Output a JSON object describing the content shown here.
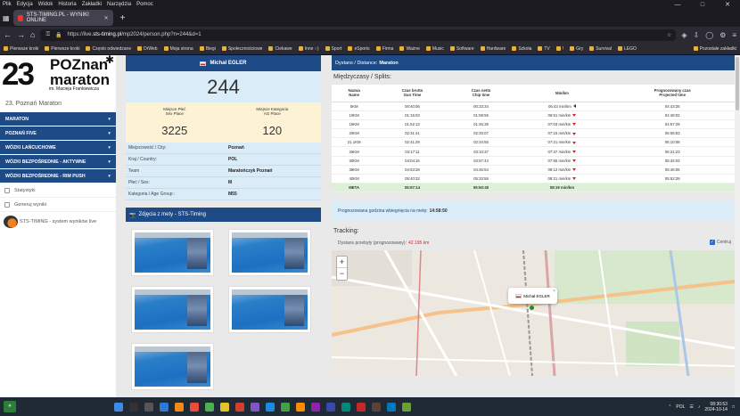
{
  "browser": {
    "menu": [
      "Plik",
      "Edycja",
      "Widok",
      "Historia",
      "Zakładki",
      "Narzędzia",
      "Pomoc"
    ],
    "tab_title": "STS-TIMING.PL - WYNIKI ONLINE",
    "url_prefix": "https://live.",
    "url_host": "sts-timing.pl",
    "url_rest": "/mp2024/person.php?n=244&d=1",
    "bookmarks": [
      "Pierwsze kroki",
      "Pierwsze kroki",
      "Często odwiedzane",
      "DrWeb",
      "Moja strona",
      "Biegi",
      "Społecznościowe",
      "Ciekawe",
      "Inne :-)",
      "Sport",
      "eSports",
      "Firma",
      "Ważne",
      "Music",
      "Software",
      "Hardware",
      "Szkoła",
      "TV",
      "!",
      "Gry",
      "Survival",
      "LEGO"
    ],
    "bookmarks_other": "Pozostałe zakładki"
  },
  "logo": {
    "number": "23",
    "line1": "POZnan",
    "line2": "maraton",
    "subtitle": "im. Macieja Frankiewicza"
  },
  "sidebar": {
    "event_title": "23. Poznań Maraton",
    "menu": [
      "MARATON",
      "POZNAŃ FIVE",
      "WÓZKI LAŃCUCHOWE",
      "WÓZKI BEZPOŚREDNIE - AKTYWNE",
      "WÓZKI BEZPOŚREDNIE - RIM PUSH"
    ],
    "links": [
      "Statystyki",
      "Generuj wyniki"
    ],
    "sts_link": "STS-TIMING - system wyników live"
  },
  "athlete": {
    "name": "Michał EGLER",
    "bib": "244",
    "place_label_1": "Miejsce Płeć",
    "place_sub_1": "Sex Place",
    "place_value_1": "3225",
    "place_label_2": "Miejsce Kategoria",
    "place_sub_2": "AG Place",
    "place_value_2": "120",
    "info": [
      {
        "k": "Miejscowość / City:",
        "v": "Poznań"
      },
      {
        "k": "Kraj / Country:",
        "v": "POL"
      },
      {
        "k": "Team",
        "v": "Maratończyk Poznań"
      },
      {
        "k": "Płeć / Sex:",
        "v": "M"
      },
      {
        "k": "Kategoria / Age Group :",
        "v": "M55"
      }
    ],
    "photos_title": "Zdjęcia z mety - STS-Timing"
  },
  "splits": {
    "distance_label": "Dystans / Distance:",
    "distance_value": "Maraton",
    "title": "Międzyczasy / Splits:",
    "headers": [
      [
        "Nazwa",
        "Name"
      ],
      [
        "Czas brutto",
        "Gun Time"
      ],
      [
        "Czas netto",
        "Chip time"
      ],
      [
        "Min/km",
        ""
      ],
      [
        "Prognozowany czas",
        "Projected time"
      ]
    ],
    "rows": [
      [
        "5KM",
        "00:40:06",
        "00:33:34",
        "06:43 min/km",
        "left",
        "04:43:25"
      ],
      [
        "10KM",
        "01:15:03",
        "01:08:59",
        "06:51 min/km",
        "down",
        "04:48:02"
      ],
      [
        "15KM",
        "01:52:13",
        "01:45:39",
        "07:03 min/km",
        "down",
        "04:57:29"
      ],
      [
        "20KM",
        "02:31:41",
        "02:25:07",
        "07:15 min/km",
        "down",
        "05:05:53"
      ],
      [
        "21.1KM",
        "02:41:29",
        "02:34:55",
        "07:21 min/km",
        "down",
        "05:10:08"
      ],
      [
        "25KM",
        "03:17:11",
        "03:10:37",
        "07:37 min/km",
        "down",
        "05:21:23"
      ],
      [
        "30KM",
        "04:04:16",
        "03:57:44",
        "07:55 min/km",
        "down",
        "05:34:03"
      ],
      [
        "35KM",
        "04:53:28",
        "04:46:54",
        "08:12 min/km",
        "down",
        "05:46:05"
      ],
      [
        "40KM",
        "05:40:32",
        "05:33:58",
        "08:21 min/km",
        "down",
        "05:52:29"
      ]
    ],
    "meta_row": [
      "META",
      "05:57:14",
      "05:50:40",
      "08:19 min/km",
      "",
      ""
    ]
  },
  "forecast": {
    "label": "Prognozowana godzina wbiegnięcia na metę:",
    "value": "14:58:50"
  },
  "tracking": {
    "title": "Tracking:",
    "covered_label": "Dystans przebyty (prognozowany):",
    "covered_value": "42.195 km",
    "center_label": "Centruj",
    "popup_name": "Michał EGLER"
  },
  "taskbar": {
    "lang": "POL",
    "time": "08:30:53",
    "date": "2024-10-14"
  },
  "colors": {
    "navy": "#1e4a85",
    "light_blue": "#d9ecf7",
    "cream": "#fdf2d4",
    "meta_green": "#dff0d8",
    "red": "#d22222"
  }
}
